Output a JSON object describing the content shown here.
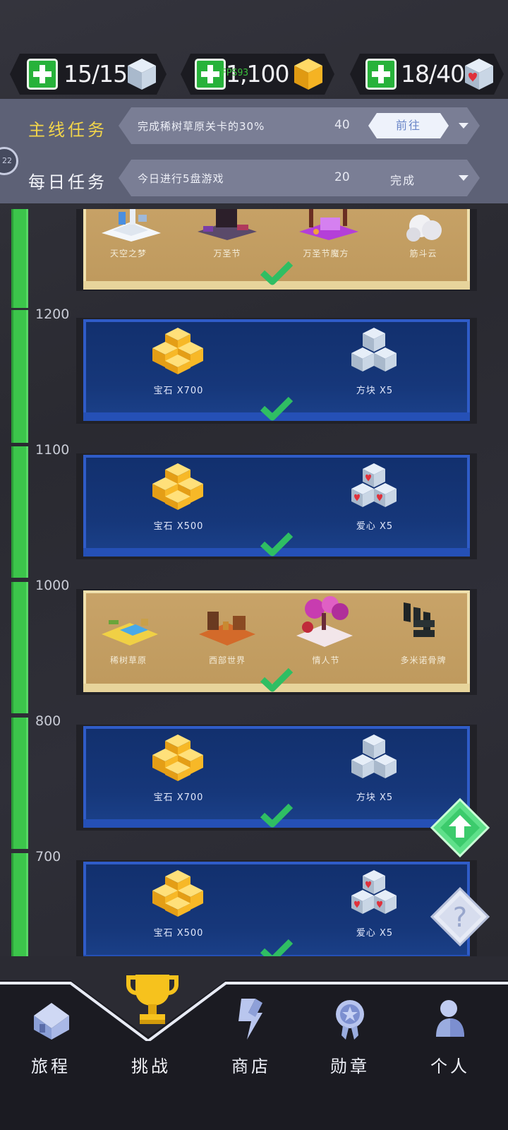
{
  "resources": {
    "cubes": {
      "value": "15/15",
      "icon": "cube-icon"
    },
    "gems": {
      "value": "1,100",
      "icon": "gem-icon"
    },
    "hearts": {
      "value": "18/40",
      "icon": "heart-cube-icon"
    },
    "fps": "FPS93"
  },
  "tasks": {
    "main": {
      "title": "主线任务",
      "desc": "完成稀树草原关卡的30%",
      "num": "40",
      "action": "前往"
    },
    "daily": {
      "title": "每日任务",
      "desc": "今日进行5盘游戏",
      "num": "20",
      "status": "完成"
    },
    "level_badge": "22"
  },
  "tiers": [
    {
      "scenes": [
        "天空之梦",
        "万圣节",
        "万圣节魔方",
        "筋斗云"
      ]
    },
    {
      "label": "1200",
      "rewards": [
        "宝石 X700",
        "方块 X5"
      ]
    },
    {
      "label": "1100",
      "rewards": [
        "宝石 X500",
        "爱心 X5"
      ]
    },
    {
      "label": "1000",
      "scenes": [
        "稀树草原",
        "西部世界",
        "情人节",
        "多米诺骨牌"
      ]
    },
    {
      "label": "800",
      "rewards": [
        "宝石 X700",
        "方块 X5"
      ]
    },
    {
      "label": "700",
      "rewards": [
        "宝石 X500",
        "爱心 X5"
      ]
    }
  ],
  "nav": {
    "journey": "旅程",
    "challenge": "挑战",
    "shop": "商店",
    "medal": "勋章",
    "profile": "个人"
  },
  "colors": {
    "track": "#3cc54b",
    "card_blue": "#16377a",
    "card_tan": "#c8a368",
    "accent_yellow": "#f2c94c"
  }
}
